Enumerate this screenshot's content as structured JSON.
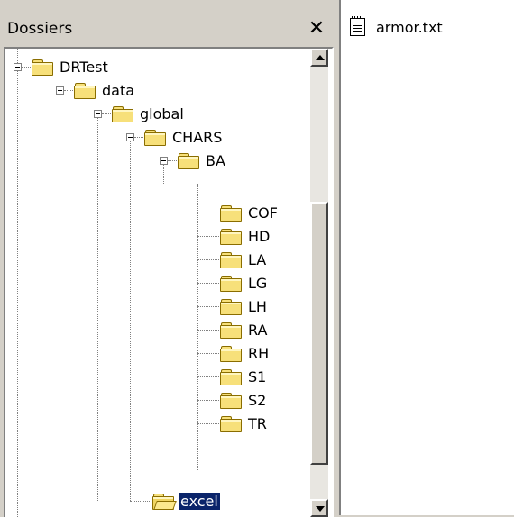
{
  "panel": {
    "title": "Dossiers",
    "close_glyph": "✕"
  },
  "tree": {
    "nodes": [
      {
        "label": "DRTest",
        "expanded": true
      },
      {
        "label": "data",
        "expanded": true
      },
      {
        "label": "global",
        "expanded": true
      },
      {
        "label": "CHARS",
        "expanded": true
      },
      {
        "label": "BA",
        "expanded": true
      },
      {
        "label": "COF"
      },
      {
        "label": "HD"
      },
      {
        "label": "LA"
      },
      {
        "label": "LG"
      },
      {
        "label": "LH"
      },
      {
        "label": "RA"
      },
      {
        "label": "RH"
      },
      {
        "label": "S1"
      },
      {
        "label": "S2"
      },
      {
        "label": "TR"
      },
      {
        "label": "excel",
        "selected": true,
        "open": true
      }
    ]
  },
  "files": {
    "items": [
      {
        "name": "armor.txt",
        "icon": "text-file-icon"
      }
    ]
  },
  "colors": {
    "selection": "#0a246a",
    "folder": "#f7e07a",
    "chrome": "#d4d0c8"
  }
}
